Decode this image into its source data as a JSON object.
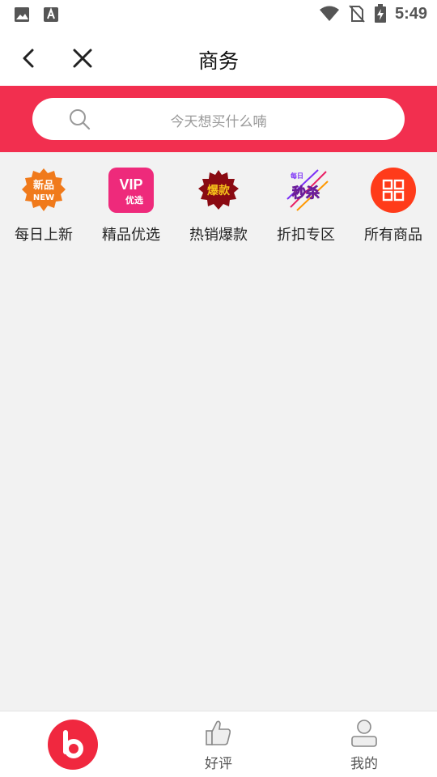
{
  "status_bar": {
    "time": "5:49",
    "left_icons": [
      "image-icon",
      "text-a-icon"
    ],
    "right_icons": [
      "wifi-icon",
      "no-sim-icon",
      "battery-charging-icon"
    ]
  },
  "nav": {
    "title": "商务",
    "back_icon": "chevron-left-icon",
    "close_icon": "close-icon"
  },
  "search": {
    "placeholder": "今天想买什么喃"
  },
  "categories": [
    {
      "label": "每日上新",
      "icon": "new-badge-icon",
      "icon_text": "新品",
      "icon_subtext": "NEW",
      "color": "#f07a1b"
    },
    {
      "label": "精品优选",
      "icon": "vip-icon",
      "icon_text": "VIP",
      "icon_subtext": "优选",
      "color": "#ee2a7b"
    },
    {
      "label": "热销爆款",
      "icon": "hot-sale-icon",
      "icon_text": "爆款",
      "color": "#8a0a12"
    },
    {
      "label": "折扣专区",
      "icon": "flash-sale-icon",
      "icon_text": "秒杀",
      "icon_subtext": "每日",
      "color": "#f2c318"
    },
    {
      "label": "所有商品",
      "icon": "grid-icon",
      "color": "#ff3b1a"
    }
  ],
  "tabbar": {
    "tabs": [
      {
        "label": "",
        "icon": "brand-logo-icon",
        "color": "#f0283f"
      },
      {
        "label": "好评",
        "icon": "thumbs-up-icon"
      },
      {
        "label": "我的",
        "icon": "profile-icon"
      }
    ]
  },
  "colors": {
    "accent": "#f22f4f",
    "background": "#f2f2f2"
  }
}
